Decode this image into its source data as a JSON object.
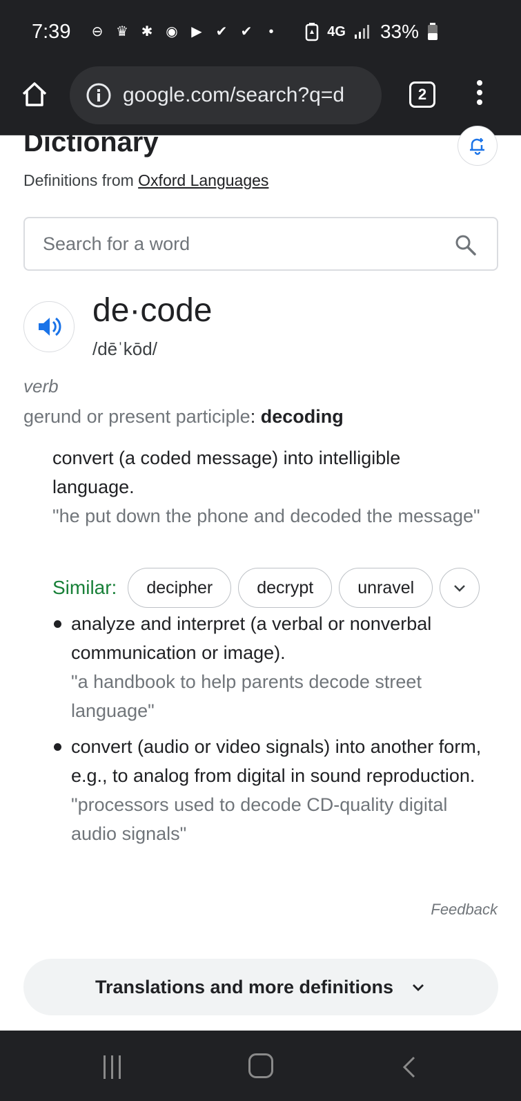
{
  "status_bar": {
    "time": "7:39",
    "network": "4G",
    "battery": "33%"
  },
  "browser": {
    "url": "google.com/search?q=d",
    "tab_count": "2"
  },
  "dictionary": {
    "title": "Dictionary",
    "from_prefix": "Definitions from ",
    "source": "Oxford Languages",
    "search_placeholder": "Search for a word",
    "word": "de·code",
    "phonetic": "/dēˈkōd/",
    "part_of_speech": "verb",
    "gerund_label": "gerund or present participle",
    "gerund_sep": ": ",
    "gerund_value": "decoding",
    "definition": "convert (a coded message) into intelligible language.",
    "example": "\"he put down the phone and decoded the message\"",
    "similar_label": "Similar:",
    "similar": [
      "decipher",
      "decrypt",
      "unravel"
    ],
    "sub_definitions": [
      {
        "definition": "analyze and interpret (a verbal or nonverbal communication or image).",
        "example": "\"a handbook to help parents decode street language\""
      },
      {
        "definition": "convert (audio or video signals) into another form, e.g., to analog from digital in sound reproduction.",
        "example": "\"processors used to decode CD-quality digital audio signals\""
      }
    ],
    "feedback": "Feedback",
    "more_button": "Translations and more definitions"
  },
  "colors": {
    "accent_blue": "#1a73e8",
    "similar_green": "#188038",
    "dark_chrome": "#202124"
  }
}
